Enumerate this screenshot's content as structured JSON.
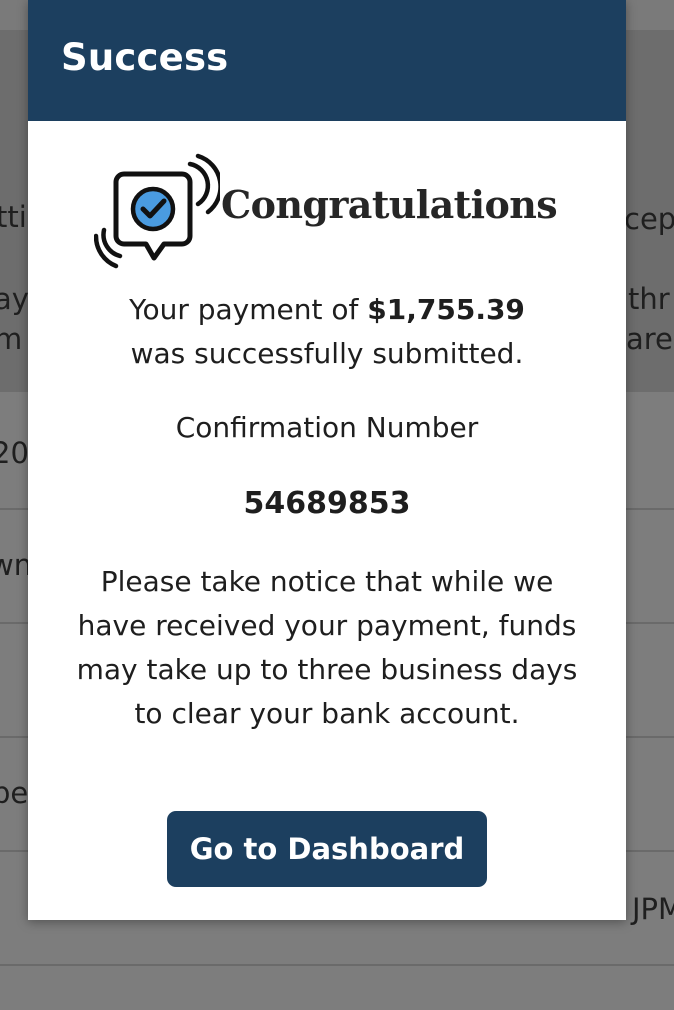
{
  "background": {
    "fragments": [
      "ttic",
      "ay",
      "m",
      "20",
      "wn",
      "pe",
      "cept",
      "thr",
      "are",
      "JPM"
    ]
  },
  "modal": {
    "title": "Success",
    "congrats_icon": "chat-bubble-checkmark-icon",
    "congrats_heading": "Congratulations",
    "payment_prefix": "Your payment of ",
    "payment_amount": "$1,755.39",
    "payment_suffix": "was successfully submitted.",
    "confirmation_label": "Confirmation Number",
    "confirmation_number": "54689853",
    "notice_text": "Please take notice that while we have received your payment, funds may take up to three business days to clear your bank account.",
    "dashboard_button": "Go to Dashboard"
  },
  "colors": {
    "header": "#1c3f5f",
    "button": "#1c3f5f",
    "check_badge": "#4a9be0",
    "overlay": "#7b7b7b"
  }
}
